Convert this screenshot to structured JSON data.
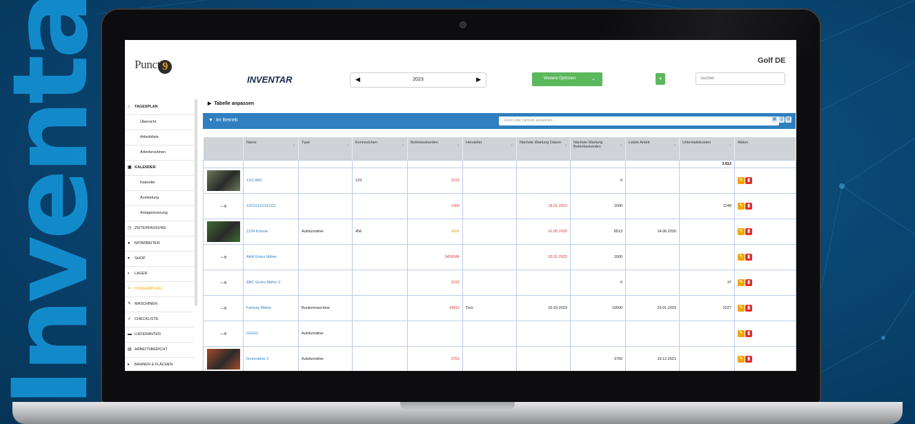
{
  "background": {
    "word": "Inventar",
    "color": "#0a4673",
    "accent": "#138fd0"
  },
  "header": {
    "logo_text": "Punct",
    "logo_nine": "9",
    "title": "INVENTAR",
    "year": "2023",
    "options_label": "Weitere Optionen",
    "add_label": "+",
    "search_placeholder": "Suchen",
    "club": "Golf DE"
  },
  "sidebar": {
    "items": [
      {
        "label": "TAGESPLAN",
        "icon": "home-icon",
        "kind": "sec"
      },
      {
        "label": "Übersicht",
        "kind": "sub"
      },
      {
        "label": "Arbeitsliste",
        "kind": "sub"
      },
      {
        "label": "Arbeitsroutinen",
        "kind": "sub"
      },
      {
        "label": "KALENDER",
        "icon": "calendar-icon",
        "kind": "sec"
      },
      {
        "label": "Kalender",
        "kind": "sub"
      },
      {
        "label": "Auslastung",
        "kind": "sub"
      },
      {
        "label": "Anlagennutzung",
        "kind": "sub"
      },
      {
        "label": "ZEITERFASSUNG",
        "icon": "clock-icon",
        "kind": "main"
      },
      {
        "label": "MITARBEITER",
        "icon": "users-icon",
        "kind": "main"
      },
      {
        "label": "SHOP",
        "icon": "cart-icon",
        "kind": "main"
      },
      {
        "label": "LAGER",
        "icon": "boxes-icon",
        "kind": "main"
      },
      {
        "label": "DÜNGERPLAN",
        "icon": "leaf-icon",
        "kind": "main",
        "active": true
      },
      {
        "label": "MASCHINEN",
        "icon": "wrench-icon",
        "kind": "main"
      },
      {
        "label": "CHECKLISTE",
        "icon": "check-icon",
        "kind": "main"
      },
      {
        "label": "LIEFERANTEN",
        "icon": "truck-icon",
        "kind": "main"
      },
      {
        "label": "ARBEITSBERICHT",
        "icon": "report-icon",
        "kind": "main"
      },
      {
        "label": "BAHNEN & FLÄCHEN",
        "icon": "flag-icon",
        "kind": "main"
      }
    ]
  },
  "main": {
    "customize_label": "Tabelle anpassen",
    "group_label": "Im Betrieb",
    "group_select_placeholder": "Einen oder mehrere auswählen ...",
    "columns": [
      "",
      "Name",
      "Type",
      "Kennzeichen",
      "Betriebsstunden",
      "Hersteller",
      "Nächste Wartung Datum",
      "Nächste Wartung Betriebsstunden",
      "Letzte Arbeit",
      "Unterhaltskosten",
      "Aktion"
    ],
    "sum_row": {
      "unterhaltskosten": "3.812"
    },
    "rows": [
      {
        "image": "photo",
        "name": "1111 ABC",
        "type": "",
        "kennzeichen": "123",
        "betriebsstunden": "2222",
        "bs_color": "red",
        "hersteller": "",
        "wartung_datum": "",
        "wd_color": "",
        "wartung_bs": "0",
        "letzte_arbeit": "",
        "kosten": ""
      },
      {
        "image": "logo",
        "name": "1111111111111111",
        "type": "",
        "kennzeichen": "",
        "betriebsstunden": "1900",
        "bs_color": "red",
        "hersteller": "",
        "wartung_datum": "18.01.2023",
        "wd_color": "red",
        "wartung_bs": "1000",
        "letzte_arbeit": "",
        "kosten": "1248"
      },
      {
        "image": "photo",
        "name": "1234 Kubota",
        "type": "Aufsitzmäher",
        "kennzeichen": "456",
        "betriebsstunden": "8500",
        "bs_color": "orange",
        "hersteller": "",
        "wartung_datum": "01.05.2020",
        "wd_color": "red",
        "wartung_bs": "8513",
        "letzte_arbeit": "14.06.2020",
        "kosten": ""
      },
      {
        "image": "logo",
        "name": "AAA Grüns Mäher",
        "type": "",
        "kennzeichen": "",
        "betriebsstunden": "3456546",
        "bs_color": "red",
        "hersteller": "",
        "wartung_datum": "02.01.2023",
        "wd_color": "red",
        "wartung_bs": "1000",
        "letzte_arbeit": "",
        "kosten": ""
      },
      {
        "image": "logo",
        "name": "ABC Grüns Mäher 2",
        "type": "",
        "kennzeichen": "",
        "betriebsstunden": "2222",
        "bs_color": "red",
        "hersteller": "",
        "wartung_datum": "",
        "wd_color": "",
        "wartung_bs": "0",
        "letzte_arbeit": "",
        "kosten": "37"
      },
      {
        "image": "logo",
        "name": "Fairway Mäher",
        "type": "Bunkermaschine",
        "kennzeichen": "",
        "betriebsstunden": "14812",
        "bs_color": "red",
        "hersteller": "Toro",
        "wartung_datum": "02.03.2023",
        "wd_color": "",
        "wartung_bs": "10500",
        "letzte_arbeit": "23.01.2023",
        "kosten": "2227"
      },
      {
        "image": "logo",
        "name": "GGGG",
        "type": "Aufsitzmäher",
        "kennzeichen": "",
        "betriebsstunden": "",
        "bs_color": "",
        "hersteller": "",
        "wartung_datum": "",
        "wd_color": "",
        "wartung_bs": "",
        "letzte_arbeit": "",
        "kosten": ""
      },
      {
        "image": "photo",
        "name": "Grünmäher 2",
        "type": "Aufsitzmäher",
        "kennzeichen": "",
        "betriebsstunden": "3752",
        "bs_color": "red",
        "hersteller": "",
        "wartung_datum": "",
        "wd_color": "",
        "wartung_bs": "3750",
        "letzte_arbeit": "19.12.2021",
        "kosten": ""
      }
    ]
  }
}
